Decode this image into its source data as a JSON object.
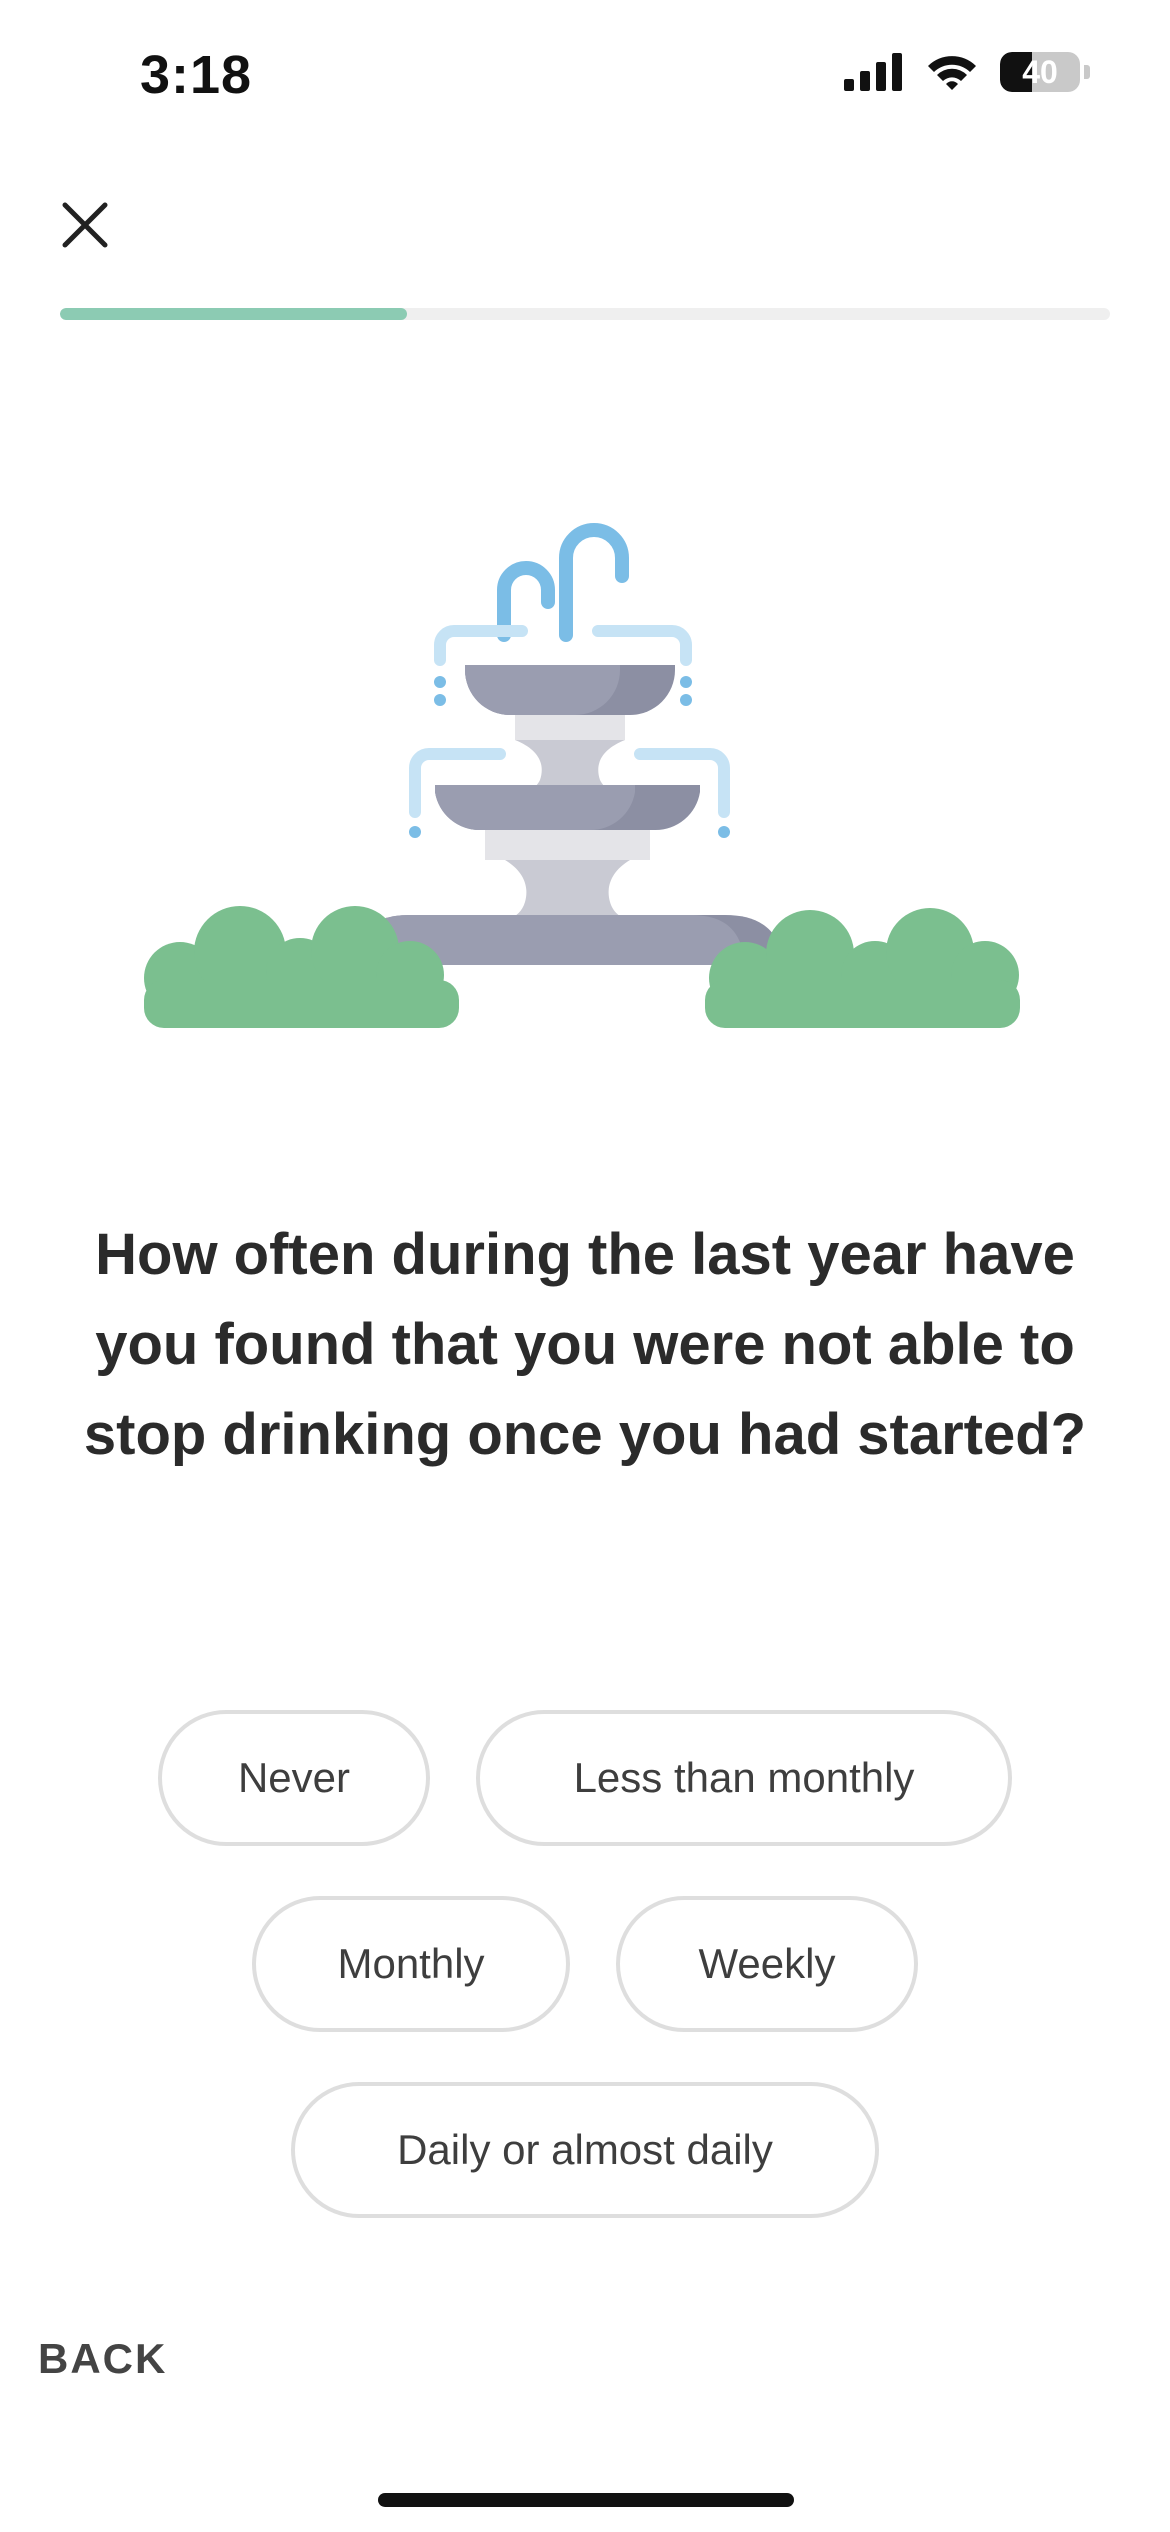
{
  "status_bar": {
    "time": "3:18",
    "battery_level": "40",
    "battery_fraction": 0.4,
    "icons": [
      "signal-icon",
      "wifi-icon",
      "battery-icon"
    ]
  },
  "header": {
    "close_icon": "close-icon",
    "progress_fraction": 0.33
  },
  "illustration": {
    "subject": "fountain-icon",
    "colors": {
      "water": "#7bbde6",
      "water_light": "#c6e3f5",
      "basin_dark": "#8c8fa3",
      "basin_light": "#c9cad3",
      "pedestal": "#e4e4e8",
      "bush": "#7bbf8f"
    }
  },
  "question": {
    "text": "How often during the last year have you found that you were not able to stop drinking once you had started?"
  },
  "answers": {
    "row1": [
      "Never",
      "Less than monthly"
    ],
    "row2": [
      "Monthly",
      "Weekly"
    ],
    "row3": [
      "Daily or almost daily"
    ]
  },
  "footer": {
    "back_label": "BACK"
  },
  "colors": {
    "accent": "#8ccbb3",
    "track": "#efefef",
    "chip_border": "#dedede",
    "text": "#2b2b2b"
  }
}
